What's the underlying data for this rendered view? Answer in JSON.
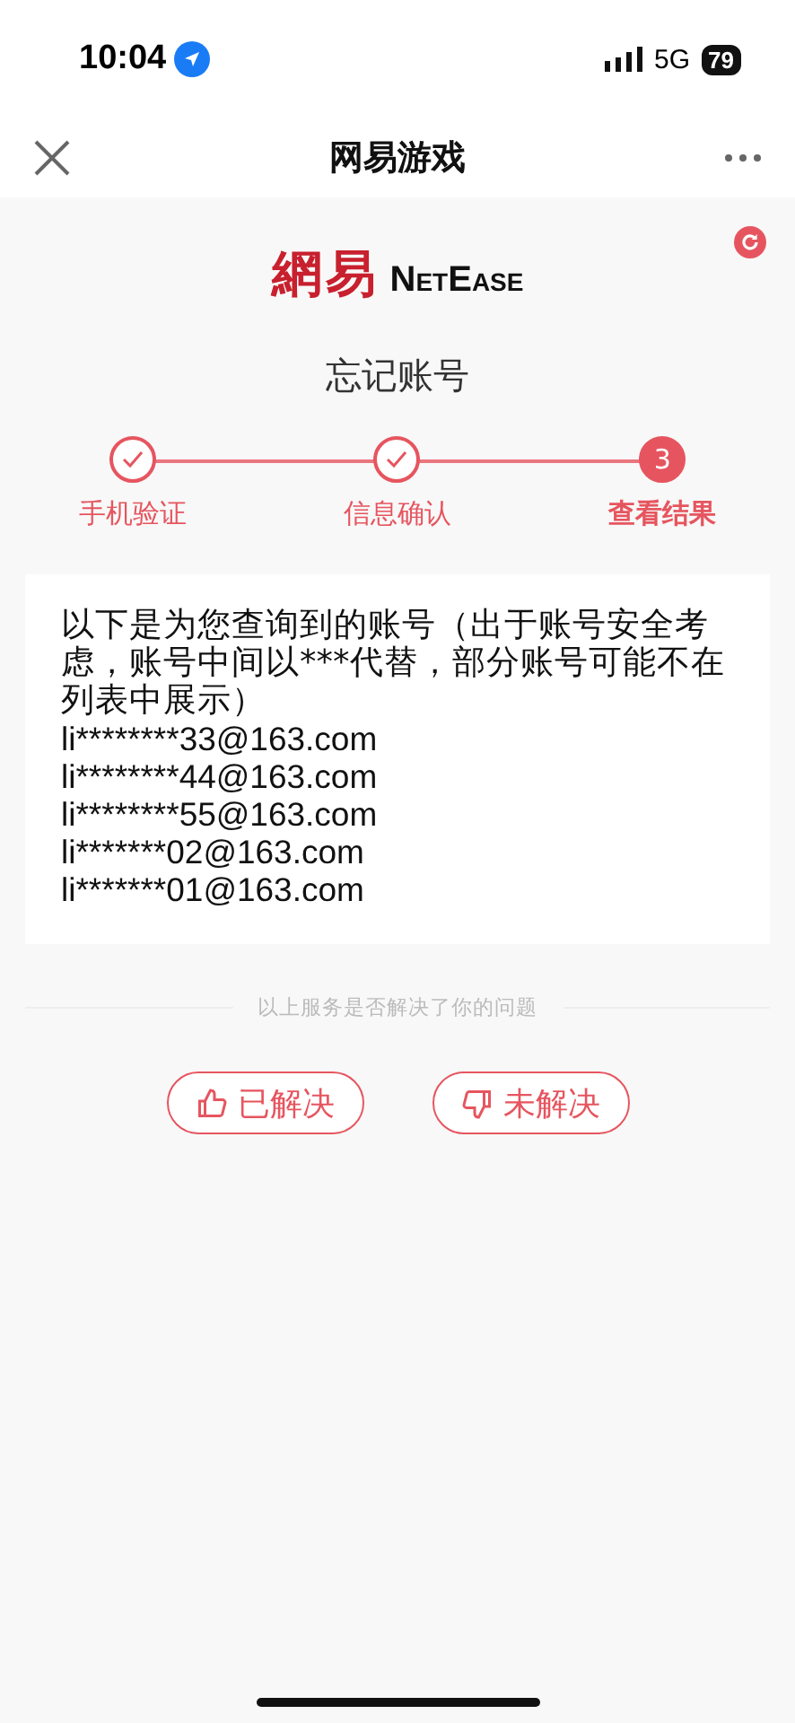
{
  "status_bar": {
    "time": "10:04",
    "network": "5G",
    "battery": "79"
  },
  "nav": {
    "title": "网易游戏"
  },
  "logo": {
    "chinese": "網易",
    "latin": "NetEase"
  },
  "page_title": "忘记账号",
  "steps": [
    {
      "label": "手机验证",
      "kind": "done"
    },
    {
      "label": "信息确认",
      "kind": "done"
    },
    {
      "label": "查看结果",
      "kind": "current",
      "number": "3"
    }
  ],
  "result": {
    "intro": "以下是为您查询到的账号（出于账号安全考虑，账号中间以***代替，部分账号可能不在列表中展示）",
    "accounts": [
      "li********33@163.com",
      "li********44@163.com",
      "li********55@163.com",
      "li*******02@163.com",
      "li*******01@163.com"
    ]
  },
  "feedback": {
    "question": "以上服务是否解决了你的问题",
    "buttons": [
      {
        "label": "已解决",
        "kind": "up"
      },
      {
        "label": "未解决",
        "kind": "down"
      }
    ]
  }
}
